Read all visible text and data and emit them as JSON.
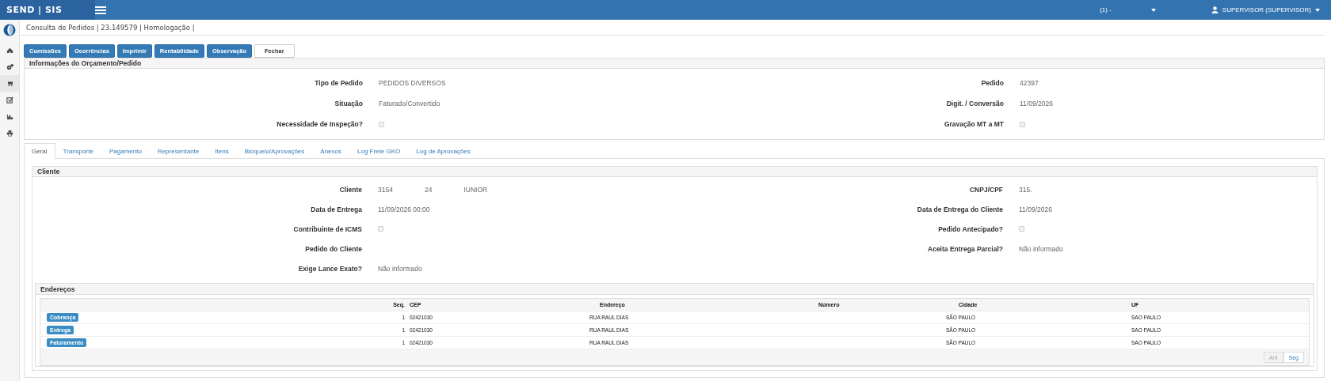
{
  "header": {
    "brand": "SEND | SIS",
    "company": "(1) -",
    "user": "SUPERVISOR (SUPERVISOR)"
  },
  "sidebar": {
    "items": [
      {
        "selected": false
      },
      {
        "selected": false
      },
      {
        "selected": true
      },
      {
        "selected": false
      },
      {
        "selected": false
      },
      {
        "selected": false
      }
    ]
  },
  "page_title": "Consulta de Pedidos | 23.149579 | Homologação |",
  "actions": [
    {
      "label": "Comissões",
      "kind": "primary"
    },
    {
      "label": "Ocorrências",
      "kind": "primary"
    },
    {
      "label": "Imprimir",
      "kind": "primary"
    },
    {
      "label": "Rentabilidade",
      "kind": "primary"
    },
    {
      "label": "Observação",
      "kind": "primary"
    },
    {
      "label": "Fechar",
      "kind": "default"
    }
  ],
  "info_panel": {
    "title": "Informações do Orçamento/Pedido",
    "fields": [
      {
        "label": "Tipo de Pedido",
        "kind": "text",
        "value": "PEDIDOS DIVERSOS"
      },
      {
        "label": "Pedido",
        "kind": "text",
        "value": "42397"
      },
      {
        "label": "Situação",
        "kind": "text",
        "value": "Faturado/Convertido"
      },
      {
        "label": "Digit. / Conversão",
        "kind": "text",
        "value": "11/09/2026"
      },
      {
        "label": "Necessidade de Inspeção?",
        "kind": "checkbox",
        "checked": false
      },
      {
        "label": "Gravação MT a MT",
        "kind": "checkbox",
        "checked": false
      }
    ]
  },
  "tabs": [
    {
      "label": "Geral",
      "selected": true
    },
    {
      "label": "Transporte",
      "selected": false
    },
    {
      "label": "Pagamento",
      "selected": false
    },
    {
      "label": "Representante",
      "selected": false
    },
    {
      "label": "Itens",
      "selected": false
    },
    {
      "label": "Bloqueio/Aprovações",
      "selected": false
    },
    {
      "label": "Anexos",
      "selected": false
    },
    {
      "label": "Log Frete GKO",
      "selected": false
    },
    {
      "label": "Log de Aprovações",
      "selected": false
    }
  ],
  "client_panel": {
    "title": "Cliente",
    "fields": [
      {
        "label": "Cliente",
        "kind": "parts",
        "parts": [
          "3154",
          "24",
          "IUNIOR"
        ]
      },
      {
        "label": "CNPJ/CPF",
        "kind": "text",
        "value": "315."
      },
      {
        "label": "Data de Entrega",
        "kind": "text",
        "value": "11/09/2026 00:00"
      },
      {
        "label": "Data de Entrega do Cliente",
        "kind": "text",
        "value": "11/09/2026"
      },
      {
        "label": "Contribuinte de ICMS",
        "kind": "checkbox",
        "checked": false
      },
      {
        "label": "Pedido Antecipado?",
        "kind": "checkbox",
        "checked": false
      },
      {
        "label": "Pedido do Cliente",
        "kind": "empty"
      },
      {
        "label": "Aceita Entrega Parcial?",
        "kind": "text",
        "value": "Não informado"
      },
      {
        "label": "Exige Lance Exato?",
        "kind": "text",
        "value": "Não informado"
      }
    ]
  },
  "addresses": {
    "title": "Endereços",
    "columns": [
      "Seq.",
      "CEP",
      "Endereço",
      "Número",
      "Cidade",
      "UF"
    ],
    "rows": [
      {
        "type": "Cobrança",
        "seq": "1",
        "cep": "02421030",
        "endereco": "RUA RAUL DIAS",
        "cidade": "SÃO PAULO",
        "uf": "SAO PAULO"
      },
      {
        "type": "Entrega",
        "seq": "1",
        "cep": "02421030",
        "endereco": "RUA RAUL DIAS",
        "cidade": "SÃO PAULO",
        "uf": "SAO PAULO"
      },
      {
        "type": "Faturamento",
        "seq": "1",
        "cep": "02421030",
        "endereco": "RUA RAUL DIAS",
        "cidade": "SÃO PAULO",
        "uf": "SAO PAULO"
      }
    ],
    "pager": [
      {
        "label": "Ant",
        "disabled": true
      },
      {
        "label": "Seg",
        "disabled": false
      }
    ]
  }
}
